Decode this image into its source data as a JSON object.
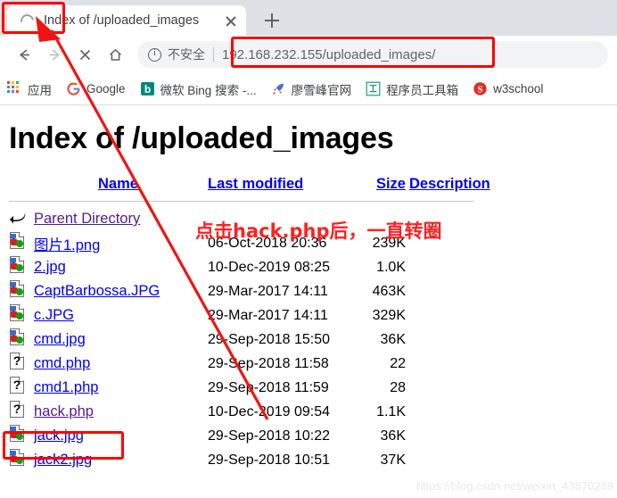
{
  "browser": {
    "tab": {
      "title": "Index of /uploaded_images",
      "loading_icon": "spinner-icon",
      "close_icon": "close-icon"
    },
    "new_tab_icon": "plus-icon",
    "toolbar": {
      "back_icon": "back-arrow-icon",
      "forward_icon": "forward-arrow-icon",
      "stop_icon": "stop-x-icon",
      "home_icon": "home-icon",
      "security_icon": "info-circle-icon",
      "security_label": "不安全",
      "url": "192.168.232.155/uploaded_images/"
    },
    "bookmarks": [
      {
        "label": "应用",
        "icon": "apps-grid-icon"
      },
      {
        "label": "Google",
        "icon": "google-g-icon"
      },
      {
        "label": "微软 Bing 搜索 -...",
        "icon": "bing-b-icon"
      },
      {
        "label": "廖雪峰官网",
        "icon": "rocket-icon"
      },
      {
        "label": "程序员工具箱",
        "icon": "toolbox-icon"
      },
      {
        "label": "w3school",
        "icon": "w3school-icon"
      }
    ]
  },
  "page": {
    "title": "Index of /uploaded_images",
    "headers": {
      "name": "Name",
      "last_modified": "Last modified",
      "size": "Size",
      "description": "Description"
    },
    "parent_directory": {
      "label": "Parent Directory",
      "icon": "parent-directory-icon",
      "visited": true
    },
    "files": [
      {
        "name": "图片1.png",
        "icon": "image-file-icon",
        "modified": "06-Oct-2018 20:36",
        "size": "239K",
        "description": "",
        "visited": false
      },
      {
        "name": "2.jpg",
        "icon": "image-file-icon",
        "modified": "10-Dec-2019 08:25",
        "size": "1.0K",
        "description": "",
        "visited": false
      },
      {
        "name": "CaptBarbossa.JPG",
        "icon": "image-file-icon",
        "modified": "29-Mar-2017 14:11",
        "size": "463K",
        "description": "",
        "visited": false
      },
      {
        "name": "c.JPG",
        "icon": "image-file-icon",
        "modified": "29-Mar-2017 14:11",
        "size": "329K",
        "description": "",
        "visited": false
      },
      {
        "name": "cmd.jpg",
        "icon": "image-file-icon",
        "modified": "29-Sep-2018 15:50",
        "size": "36K",
        "description": "",
        "visited": false
      },
      {
        "name": "cmd.php",
        "icon": "unknown-file-icon",
        "modified": "29-Sep-2018 11:58",
        "size": "22",
        "description": "",
        "visited": false
      },
      {
        "name": "cmd1.php",
        "icon": "unknown-file-icon",
        "modified": "29-Sep-2018 11:59",
        "size": "28",
        "description": "",
        "visited": false
      },
      {
        "name": "hack.php",
        "icon": "unknown-file-icon",
        "modified": "10-Dec-2019 09:54",
        "size": "1.1K",
        "description": "",
        "visited": true
      },
      {
        "name": "jack.jpg",
        "icon": "image-file-icon",
        "modified": "29-Sep-2018 10:22",
        "size": "36K",
        "description": "",
        "visited": false
      },
      {
        "name": "jack2.jpg",
        "icon": "image-file-icon",
        "modified": "29-Sep-2018 10:51",
        "size": "37K",
        "description": "",
        "visited": false
      }
    ]
  },
  "annotations": {
    "note_text": "点击hack.php后，一直转圈",
    "highlight_color": "#ff0000",
    "boxes": [
      "tab-spinner-box",
      "url-box",
      "hack-php-box"
    ],
    "arrow": "red-arrow-pointing-to-tab-spinner"
  },
  "watermark": "https://blog.csdn.net/weixin_43870289"
}
